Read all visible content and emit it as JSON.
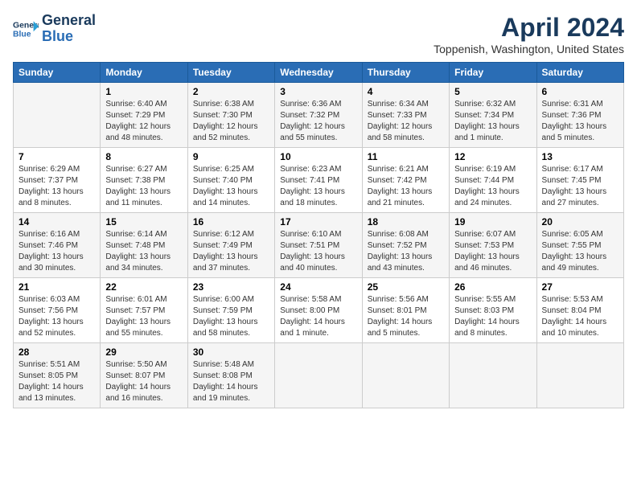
{
  "header": {
    "logo_line1": "General",
    "logo_line2": "Blue",
    "month_title": "April 2024",
    "location": "Toppenish, Washington, United States"
  },
  "columns": [
    "Sunday",
    "Monday",
    "Tuesday",
    "Wednesday",
    "Thursday",
    "Friday",
    "Saturday"
  ],
  "weeks": [
    [
      {
        "day": "",
        "info": ""
      },
      {
        "day": "1",
        "info": "Sunrise: 6:40 AM\nSunset: 7:29 PM\nDaylight: 12 hours\nand 48 minutes."
      },
      {
        "day": "2",
        "info": "Sunrise: 6:38 AM\nSunset: 7:30 PM\nDaylight: 12 hours\nand 52 minutes."
      },
      {
        "day": "3",
        "info": "Sunrise: 6:36 AM\nSunset: 7:32 PM\nDaylight: 12 hours\nand 55 minutes."
      },
      {
        "day": "4",
        "info": "Sunrise: 6:34 AM\nSunset: 7:33 PM\nDaylight: 12 hours\nand 58 minutes."
      },
      {
        "day": "5",
        "info": "Sunrise: 6:32 AM\nSunset: 7:34 PM\nDaylight: 13 hours\nand 1 minute."
      },
      {
        "day": "6",
        "info": "Sunrise: 6:31 AM\nSunset: 7:36 PM\nDaylight: 13 hours\nand 5 minutes."
      }
    ],
    [
      {
        "day": "7",
        "info": "Sunrise: 6:29 AM\nSunset: 7:37 PM\nDaylight: 13 hours\nand 8 minutes."
      },
      {
        "day": "8",
        "info": "Sunrise: 6:27 AM\nSunset: 7:38 PM\nDaylight: 13 hours\nand 11 minutes."
      },
      {
        "day": "9",
        "info": "Sunrise: 6:25 AM\nSunset: 7:40 PM\nDaylight: 13 hours\nand 14 minutes."
      },
      {
        "day": "10",
        "info": "Sunrise: 6:23 AM\nSunset: 7:41 PM\nDaylight: 13 hours\nand 18 minutes."
      },
      {
        "day": "11",
        "info": "Sunrise: 6:21 AM\nSunset: 7:42 PM\nDaylight: 13 hours\nand 21 minutes."
      },
      {
        "day": "12",
        "info": "Sunrise: 6:19 AM\nSunset: 7:44 PM\nDaylight: 13 hours\nand 24 minutes."
      },
      {
        "day": "13",
        "info": "Sunrise: 6:17 AM\nSunset: 7:45 PM\nDaylight: 13 hours\nand 27 minutes."
      }
    ],
    [
      {
        "day": "14",
        "info": "Sunrise: 6:16 AM\nSunset: 7:46 PM\nDaylight: 13 hours\nand 30 minutes."
      },
      {
        "day": "15",
        "info": "Sunrise: 6:14 AM\nSunset: 7:48 PM\nDaylight: 13 hours\nand 34 minutes."
      },
      {
        "day": "16",
        "info": "Sunrise: 6:12 AM\nSunset: 7:49 PM\nDaylight: 13 hours\nand 37 minutes."
      },
      {
        "day": "17",
        "info": "Sunrise: 6:10 AM\nSunset: 7:51 PM\nDaylight: 13 hours\nand 40 minutes."
      },
      {
        "day": "18",
        "info": "Sunrise: 6:08 AM\nSunset: 7:52 PM\nDaylight: 13 hours\nand 43 minutes."
      },
      {
        "day": "19",
        "info": "Sunrise: 6:07 AM\nSunset: 7:53 PM\nDaylight: 13 hours\nand 46 minutes."
      },
      {
        "day": "20",
        "info": "Sunrise: 6:05 AM\nSunset: 7:55 PM\nDaylight: 13 hours\nand 49 minutes."
      }
    ],
    [
      {
        "day": "21",
        "info": "Sunrise: 6:03 AM\nSunset: 7:56 PM\nDaylight: 13 hours\nand 52 minutes."
      },
      {
        "day": "22",
        "info": "Sunrise: 6:01 AM\nSunset: 7:57 PM\nDaylight: 13 hours\nand 55 minutes."
      },
      {
        "day": "23",
        "info": "Sunrise: 6:00 AM\nSunset: 7:59 PM\nDaylight: 13 hours\nand 58 minutes."
      },
      {
        "day": "24",
        "info": "Sunrise: 5:58 AM\nSunset: 8:00 PM\nDaylight: 14 hours\nand 1 minute."
      },
      {
        "day": "25",
        "info": "Sunrise: 5:56 AM\nSunset: 8:01 PM\nDaylight: 14 hours\nand 5 minutes."
      },
      {
        "day": "26",
        "info": "Sunrise: 5:55 AM\nSunset: 8:03 PM\nDaylight: 14 hours\nand 8 minutes."
      },
      {
        "day": "27",
        "info": "Sunrise: 5:53 AM\nSunset: 8:04 PM\nDaylight: 14 hours\nand 10 minutes."
      }
    ],
    [
      {
        "day": "28",
        "info": "Sunrise: 5:51 AM\nSunset: 8:05 PM\nDaylight: 14 hours\nand 13 minutes."
      },
      {
        "day": "29",
        "info": "Sunrise: 5:50 AM\nSunset: 8:07 PM\nDaylight: 14 hours\nand 16 minutes."
      },
      {
        "day": "30",
        "info": "Sunrise: 5:48 AM\nSunset: 8:08 PM\nDaylight: 14 hours\nand 19 minutes."
      },
      {
        "day": "",
        "info": ""
      },
      {
        "day": "",
        "info": ""
      },
      {
        "day": "",
        "info": ""
      },
      {
        "day": "",
        "info": ""
      }
    ]
  ]
}
